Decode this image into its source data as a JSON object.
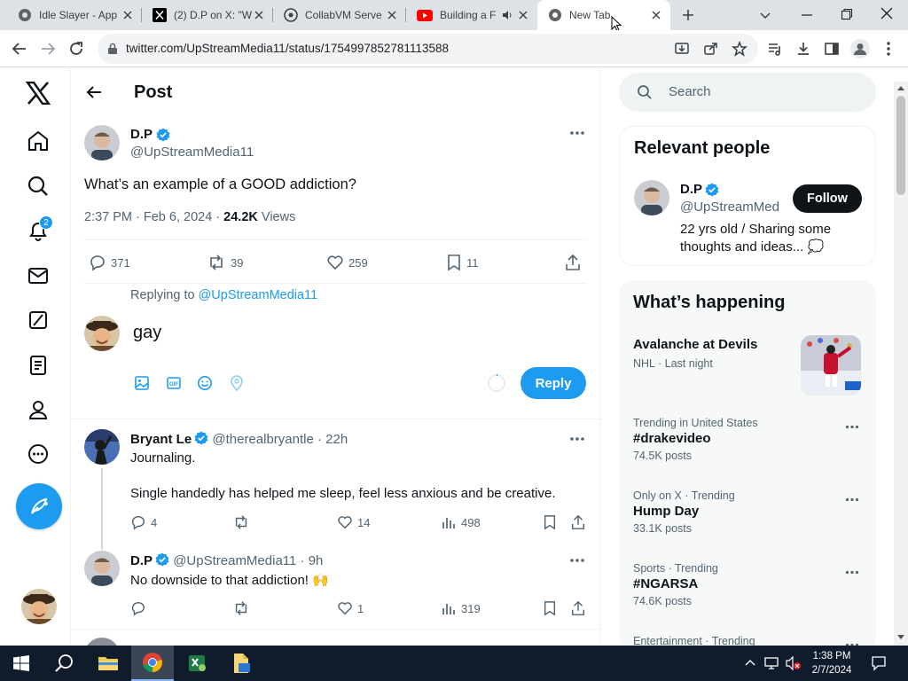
{
  "browser": {
    "tabs": [
      {
        "title": "Idle Slayer - App",
        "icon": "chrome-globe-icon"
      },
      {
        "title": "(2) D.P on X: \"W",
        "icon": "x-logo-icon"
      },
      {
        "title": "CollabVM Serve",
        "icon": "collabvm-icon"
      },
      {
        "title": "Building a F",
        "icon": "youtube-icon"
      },
      {
        "title": "New Tab",
        "icon": "chrome-icon"
      }
    ],
    "url": "twitter.com/UpStreamMedia11/status/1754997852781113588"
  },
  "header": {
    "title": "Post"
  },
  "search": {
    "placeholder": "Search"
  },
  "nav": {
    "notification_badge": "2"
  },
  "main_post": {
    "name": "D.P",
    "handle": "@UpStreamMedia11",
    "text": "What’s an example of a GOOD addiction?",
    "time": "2:37 PM · Feb 6, 2024 · ",
    "views_count": "24.2K",
    "views_label": " Views",
    "replies": "371",
    "reposts": "39",
    "likes": "259",
    "bookmarks": "11"
  },
  "composer": {
    "replying_prefix": "Replying to ",
    "replying_handle": "@UpStreamMedia11",
    "draft": "gay",
    "reply_button": "Reply"
  },
  "replies": [
    {
      "name": "Bryant Le",
      "handle": "@therealbryantle",
      "time": "· 22h",
      "line1": "Journaling.",
      "line2": "Single handedly has helped me sleep, feel less anxious and be creative.",
      "replies": "4",
      "reposts": "",
      "likes": "14",
      "views": "498"
    },
    {
      "name": "D.P",
      "handle": "@UpStreamMedia11",
      "time": "· 9h",
      "line1": "No downside to that addiction! 🙌",
      "replies": "",
      "reposts": "",
      "likes": "1",
      "views": "319"
    }
  ],
  "relevant_people": {
    "heading": "Relevant people",
    "name": "D.P",
    "handle": "@UpStreamMed",
    "bio": "22 yrs old / Sharing some thoughts and ideas... 💭",
    "follow": "Follow"
  },
  "happening": {
    "heading": "What’s happening",
    "featured": {
      "title": "Avalanche at Devils",
      "meta": "NHL · Last night"
    },
    "trends": [
      {
        "meta": "Trending in United States",
        "title": "#drakevideo",
        "posts": "74.5K posts"
      },
      {
        "meta": "Only on X · Trending",
        "title": "Hump Day",
        "posts": "33.1K posts"
      },
      {
        "meta": "Sports · Trending",
        "title": "#NGARSA",
        "posts": "74.6K posts"
      },
      {
        "meta": "Entertainment · Trending",
        "title": "",
        "posts": ""
      }
    ]
  },
  "taskbar": {
    "time": "1:38 PM",
    "date": "2/7/2024"
  },
  "colors": {
    "accent": "#1d9bf0",
    "text": "#0f1419",
    "muted": "#536471",
    "taskbar": "#101c2c"
  }
}
